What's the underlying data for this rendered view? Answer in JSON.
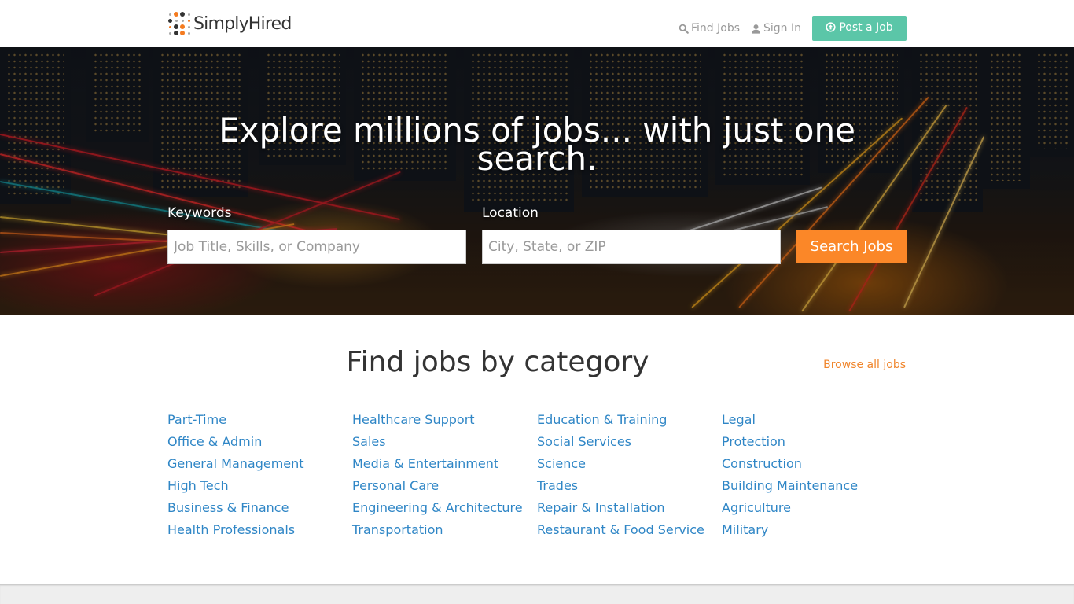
{
  "header": {
    "logo_text": "SimplyHired",
    "nav": [
      {
        "label": "Find Jobs",
        "icon": "search-icon"
      },
      {
        "label": "Sign In",
        "icon": "user-icon"
      }
    ],
    "post_job_label": "Post a Job",
    "post_job_icon": "arrow-up-circle-icon"
  },
  "hero": {
    "title": "Explore millions of jobs... with just one search.",
    "keywords_label": "Keywords",
    "keywords_placeholder": "Job Title, Skills, or Company",
    "keywords_value": "",
    "location_label": "Location",
    "location_placeholder": "City, State, or ZIP",
    "location_value": "",
    "search_button": "Search Jobs"
  },
  "categories": {
    "title": "Find jobs by category",
    "browse_all": "Browse all jobs",
    "columns": [
      [
        "Part-Time",
        "Office & Admin",
        "General Management",
        "High Tech",
        "Business & Finance",
        "Health Professionals"
      ],
      [
        "Healthcare Support",
        "Sales",
        "Media & Entertainment",
        "Personal Care",
        "Engineering & Architecture",
        "Transportation"
      ],
      [
        "Education & Training",
        "Social Services",
        "Science",
        "Trades",
        "Repair & Installation",
        "Restaurant & Food Service"
      ],
      [
        "Legal",
        "Protection",
        "Construction",
        "Building Maintenance",
        "Agriculture",
        "Military"
      ]
    ]
  },
  "colors": {
    "brand_orange": "#fb8728",
    "post_job_green": "#5bc6a8",
    "link_blue": "#2f86c6",
    "browse_orange": "#f0852b"
  }
}
